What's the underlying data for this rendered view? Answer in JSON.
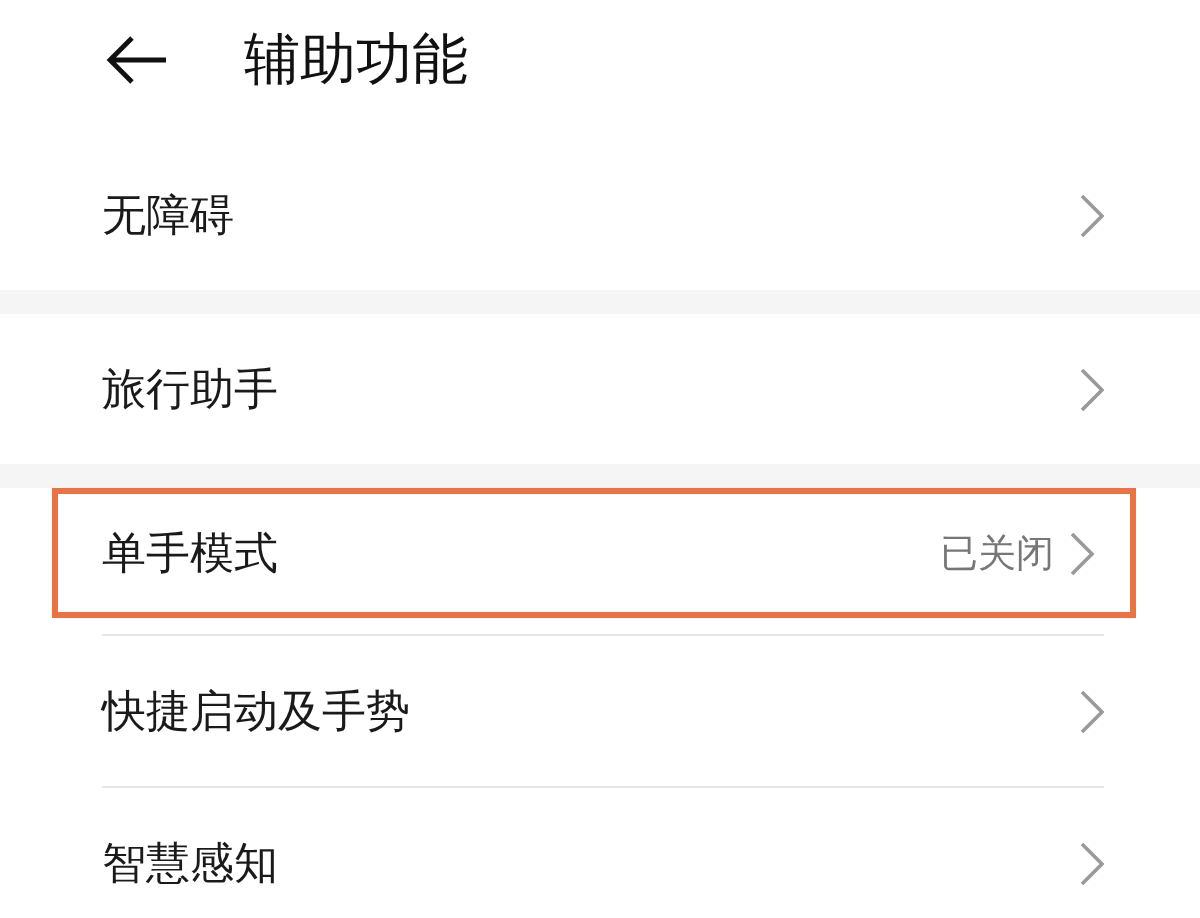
{
  "header": {
    "title": "辅助功能"
  },
  "groups": [
    {
      "rows": [
        {
          "label": "无障碍",
          "highlighted": false
        }
      ]
    },
    {
      "rows": [
        {
          "label": "旅行助手",
          "highlighted": false
        }
      ]
    },
    {
      "rows": [
        {
          "label": "单手模式",
          "value": "已关闭",
          "highlighted": true
        },
        {
          "label": "快捷启动及手势",
          "highlighted": false
        },
        {
          "label": "智慧感知",
          "highlighted": false
        }
      ]
    }
  ]
}
